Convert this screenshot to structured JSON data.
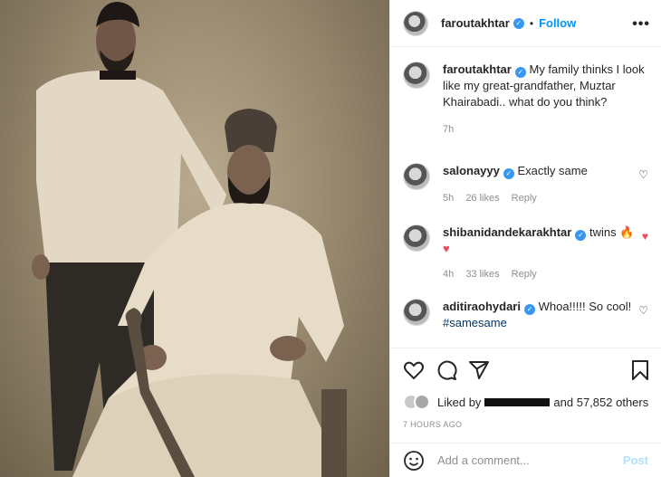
{
  "post": {
    "username": "faroutakhtar",
    "follow_label": "Follow",
    "dot": "•",
    "more_label": "•••"
  },
  "caption": {
    "username": "faroutakhtar",
    "text": "My family thinks I look like my great-grandfather, Muztar Khairabadi.. what do you think?",
    "age": "7h"
  },
  "comments": [
    {
      "username": "salonayyy",
      "text": "Exactly same",
      "age": "5h",
      "likes": "26 likes",
      "reply": "Reply",
      "liked": false
    },
    {
      "username": "shibanidandekarakhtar",
      "text": "twins 🔥",
      "extra": "♥",
      "age": "4h",
      "likes": "33 likes",
      "reply": "Reply",
      "liked": true
    },
    {
      "username": "aditiraohydari",
      "text": "Whoa!!!!! So cool!",
      "tag": "#samesame",
      "liked": false
    }
  ],
  "likes": {
    "prefix": "Liked by",
    "suffix": "and 57,852 others"
  },
  "timestamp": "7 HOURS AGO",
  "add_comment": {
    "placeholder": "Add a comment...",
    "post_label": "Post"
  },
  "icons": [
    "more-icon",
    "heart-icon",
    "comment-icon",
    "share-icon",
    "bookmark-icon",
    "emoji-icon",
    "verified-icon"
  ],
  "colors": {
    "link": "#0095f6",
    "verified": "#3897f0",
    "like_red": "#ed4956",
    "post_disabled": "#b2dffc"
  }
}
